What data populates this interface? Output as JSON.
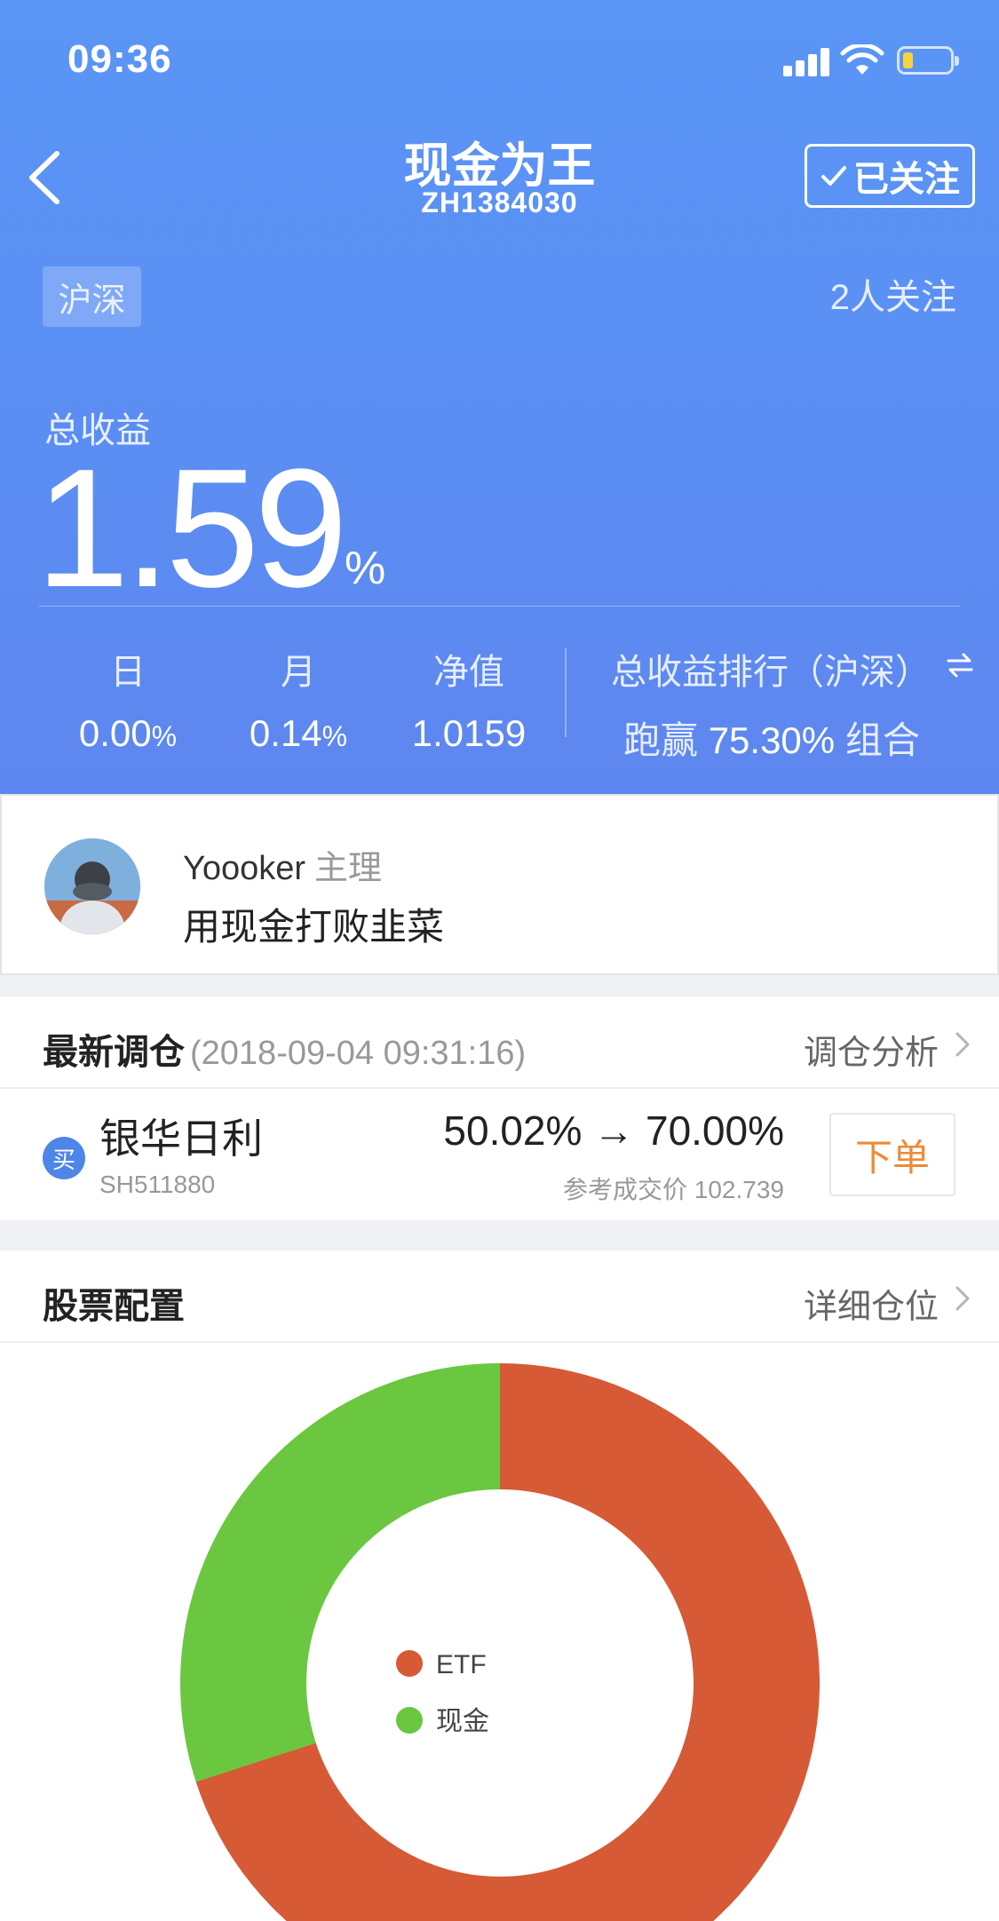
{
  "status_bar": {
    "time": "09:36"
  },
  "nav": {
    "title": "现金为王",
    "subtitle": "ZH1384030",
    "follow_label": "已关注"
  },
  "header": {
    "market_tag": "沪深",
    "followers": "2人关注",
    "total_label": "总收益",
    "total_value": "1.59",
    "total_unit": "%",
    "stats": [
      {
        "label": "日",
        "value": "0.00",
        "unit": "%"
      },
      {
        "label": "月",
        "value": "0.14",
        "unit": "%"
      },
      {
        "label": "净值",
        "value": "1.0159",
        "unit": ""
      }
    ],
    "rank_label": "总收益排行（沪深）",
    "rank_prefix": "跑赢",
    "rank_value": "75.30%",
    "rank_suffix": "组合"
  },
  "owner": {
    "name": "Yoooker",
    "role": "主理",
    "description": "用现金打败韭菜"
  },
  "rebalance": {
    "title": "最新调仓",
    "timestamp": "(2018-09-04 09:31:16)",
    "link": "调仓分析",
    "trade": {
      "badge": "买",
      "stock_name": "银华日利",
      "stock_code": "SH511880",
      "weight_change": "50.02% → 70.00%",
      "ref_price": "参考成交价 102.739",
      "order_label": "下单"
    }
  },
  "allocation": {
    "title": "股票配置",
    "link": "详细仓位"
  },
  "colors": {
    "header_blue": "#5a92f5",
    "etf": "#d55a35",
    "cash": "#6ac73f",
    "order": "#ef8a36"
  },
  "chart_data": {
    "type": "pie",
    "donut": true,
    "categories": [
      "ETF",
      "现金"
    ],
    "values": [
      70,
      30
    ],
    "unit": "%",
    "legend": "center",
    "colors": [
      "#d55a35",
      "#6ac73f"
    ]
  }
}
